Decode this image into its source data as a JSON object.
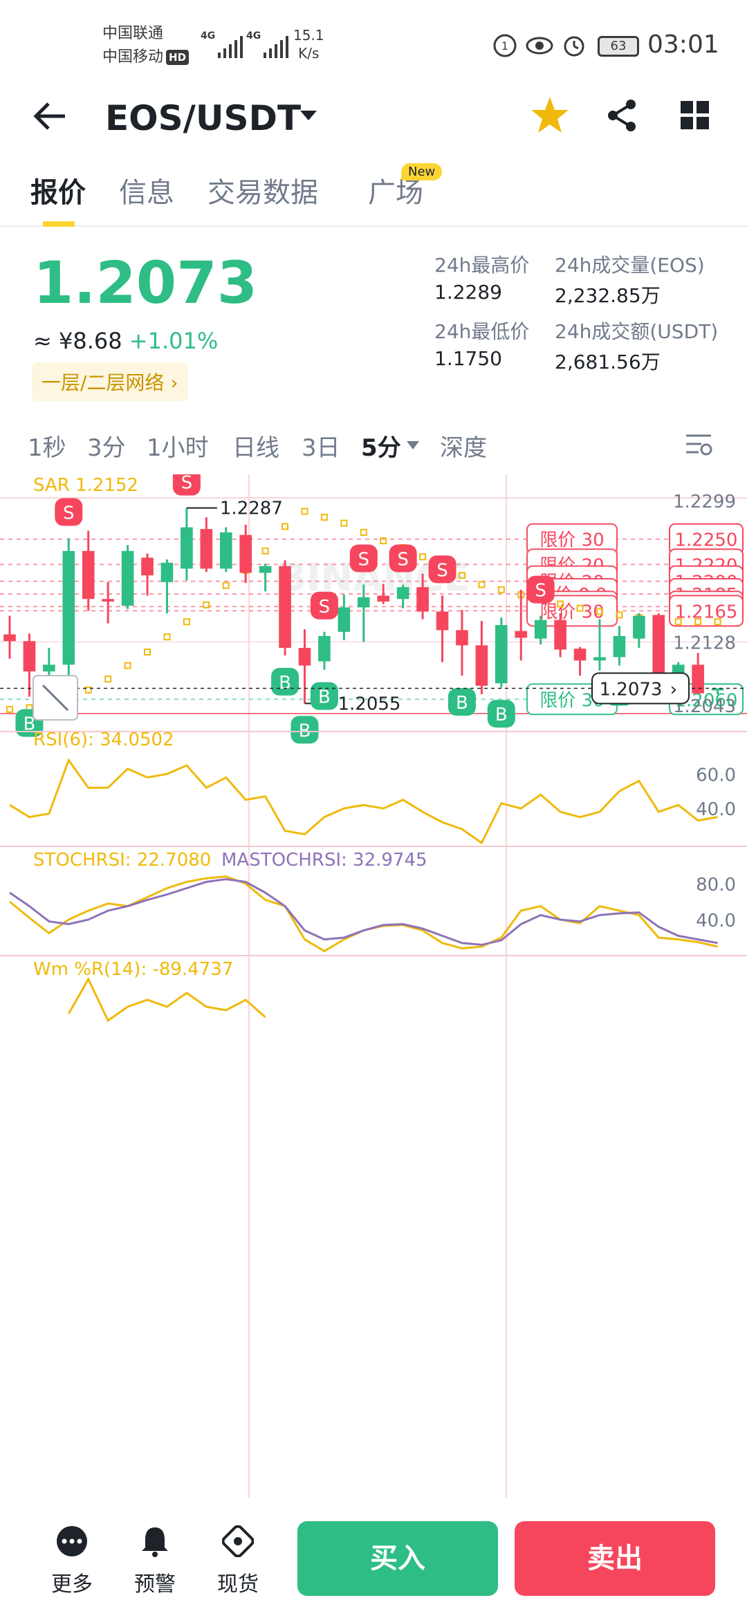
{
  "status_bar": {
    "carrier1": "中国联通",
    "carrier2": "中国移动",
    "hd": "HD",
    "net1": "4G",
    "net2": "4G",
    "speed_value": "15.1",
    "speed_unit": "K/s",
    "battery": "63",
    "time": "03:01"
  },
  "header": {
    "pair": "EOS/USDT",
    "icons": [
      "back-arrow-icon",
      "chevron-down-icon",
      "star-icon",
      "share-icon",
      "grid-icon"
    ],
    "star_color": "#f0b90b"
  },
  "tabs": [
    {
      "label": "报价",
      "active": true
    },
    {
      "label": "信息",
      "active": false
    },
    {
      "label": "交易数据",
      "active": false
    },
    {
      "label": "广场",
      "active": false,
      "badge": "New"
    }
  ],
  "ticker": {
    "price": "1.2073",
    "cny": "≈ ¥8.68",
    "change": "+1.01%",
    "layer_link": "一层/二层网络",
    "high_label": "24h最高价",
    "high": "1.2289",
    "low_label": "24h最低价",
    "low": "1.1750",
    "vol_label": "24h成交量(EOS)",
    "vol": "2,232.85万",
    "amt_label": "24h成交额(USDT)",
    "amt": "2,681.56万"
  },
  "intervals": [
    {
      "label": "1秒"
    },
    {
      "label": "3分"
    },
    {
      "label": "1小时"
    },
    {
      "label": "日线"
    },
    {
      "label": "3日"
    },
    {
      "label": "5分",
      "active": true
    },
    {
      "label": "深度"
    }
  ],
  "colors": {
    "up": "#2ebd85",
    "down": "#f6465d",
    "accent": "#fcd535",
    "sar": "#f0b90b",
    "mastoch": "#8e72b8"
  },
  "chart_data": {
    "type": "candlestick",
    "sar_label": "SAR 1.2152",
    "watermark": "BINANCE",
    "price_axis": [
      "1.2299",
      "1.2250",
      "1.2220",
      "1.2200",
      "1.2185",
      "1.2170",
      "1.2165",
      "1.2128",
      "1.2060",
      "1.2043"
    ],
    "last_price_tag": "1.2073",
    "high_marker": "1.2287",
    "low_marker": "1.2055",
    "order_lines": [
      {
        "label": "限价  30",
        "price": "1.2250",
        "side": "sell"
      },
      {
        "label": "限价  20",
        "price": "1.2220",
        "side": "sell"
      },
      {
        "label": "限价  20",
        "price": "1.2200",
        "side": "sell"
      },
      {
        "label": "限价  9.9",
        "price": "1.2185",
        "side": "sell"
      },
      {
        "label": "限价  30",
        "price": "1.2170",
        "side": "sell"
      },
      {
        "label": "限价  30",
        "price": "1.2165",
        "side": "sell"
      },
      {
        "label": "限价  30",
        "price": "1.2060",
        "side": "buy"
      }
    ],
    "ylim": [
      1.2043,
      1.2299
    ],
    "candles": [
      {
        "o": 1.2137,
        "h": 1.2159,
        "l": 1.2108,
        "c": 1.2129
      },
      {
        "o": 1.2129,
        "h": 1.2138,
        "l": 1.2063,
        "c": 1.2093
      },
      {
        "o": 1.2093,
        "h": 1.2121,
        "l": 1.207,
        "c": 1.2101
      },
      {
        "o": 1.2101,
        "h": 1.2251,
        "l": 1.2082,
        "c": 1.2236
      },
      {
        "o": 1.2236,
        "h": 1.226,
        "l": 1.2165,
        "c": 1.2179
      },
      {
        "o": 1.2179,
        "h": 1.2199,
        "l": 1.215,
        "c": 1.2176
      },
      {
        "o": 1.2171,
        "h": 1.2243,
        "l": 1.2167,
        "c": 1.2236
      },
      {
        "o": 1.2228,
        "h": 1.2233,
        "l": 1.2183,
        "c": 1.2207
      },
      {
        "o": 1.2199,
        "h": 1.2226,
        "l": 1.2162,
        "c": 1.2222
      },
      {
        "o": 1.2215,
        "h": 1.2287,
        "l": 1.2201,
        "c": 1.2264
      },
      {
        "o": 1.2262,
        "h": 1.2276,
        "l": 1.2211,
        "c": 1.2215
      },
      {
        "o": 1.2215,
        "h": 1.2264,
        "l": 1.2211,
        "c": 1.2258
      },
      {
        "o": 1.2255,
        "h": 1.2267,
        "l": 1.2198,
        "c": 1.221
      },
      {
        "o": 1.221,
        "h": 1.2221,
        "l": 1.2188,
        "c": 1.2218
      },
      {
        "o": 1.2218,
        "h": 1.2225,
        "l": 1.2112,
        "c": 1.2121
      },
      {
        "o": 1.2121,
        "h": 1.2143,
        "l": 1.2055,
        "c": 1.21
      },
      {
        "o": 1.2105,
        "h": 1.214,
        "l": 1.2095,
        "c": 1.2135
      },
      {
        "o": 1.214,
        "h": 1.2184,
        "l": 1.213,
        "c": 1.2169
      },
      {
        "o": 1.2169,
        "h": 1.2196,
        "l": 1.2128,
        "c": 1.2181
      },
      {
        "o": 1.2183,
        "h": 1.2197,
        "l": 1.2173,
        "c": 1.2176
      },
      {
        "o": 1.2179,
        "h": 1.2196,
        "l": 1.2168,
        "c": 1.2193
      },
      {
        "o": 1.2193,
        "h": 1.2209,
        "l": 1.2155,
        "c": 1.2164
      },
      {
        "o": 1.2164,
        "h": 1.2183,
        "l": 1.2104,
        "c": 1.2142
      },
      {
        "o": 1.2142,
        "h": 1.2166,
        "l": 1.2088,
        "c": 1.2124
      },
      {
        "o": 1.2124,
        "h": 1.2153,
        "l": 1.2066,
        "c": 1.2076
      },
      {
        "o": 1.2079,
        "h": 1.2157,
        "l": 1.2074,
        "c": 1.2148
      },
      {
        "o": 1.2141,
        "h": 1.219,
        "l": 1.2106,
        "c": 1.2133
      },
      {
        "o": 1.2132,
        "h": 1.2159,
        "l": 1.2125,
        "c": 1.2154
      },
      {
        "o": 1.2154,
        "h": 1.2162,
        "l": 1.211,
        "c": 1.2119
      },
      {
        "o": 1.212,
        "h": 1.2122,
        "l": 1.2088,
        "c": 1.2106
      },
      {
        "o": 1.2106,
        "h": 1.2155,
        "l": 1.2094,
        "c": 1.211
      },
      {
        "o": 1.211,
        "h": 1.2147,
        "l": 1.21,
        "c": 1.2135
      },
      {
        "o": 1.2132,
        "h": 1.2162,
        "l": 1.2121,
        "c": 1.2159
      },
      {
        "o": 1.216,
        "h": 1.2162,
        "l": 1.2081,
        "c": 1.2088
      },
      {
        "o": 1.2088,
        "h": 1.2104,
        "l": 1.2079,
        "c": 1.2101
      },
      {
        "o": 1.2101,
        "h": 1.2115,
        "l": 1.2066,
        "c": 1.2067
      },
      {
        "o": 1.2071,
        "h": 1.2073,
        "l": 1.2066,
        "c": 1.2073
      }
    ],
    "sar": [
      1.2048,
      1.205,
      1.2052,
      1.2059,
      1.2071,
      1.2084,
      1.21,
      1.2116,
      1.2134,
      1.2152,
      1.2172,
      1.2195,
      1.2213,
      1.2236,
      1.2265,
      1.2283,
      1.2276,
      1.2269,
      1.2258,
      1.2248,
      1.224,
      1.2229,
      1.2218,
      1.2207,
      1.2196,
      1.219,
      1.2184,
      1.2178,
      1.2173,
      1.2168,
      1.2164,
      1.216,
      1.2157,
      1.2154,
      1.2152,
      1.2152,
      1.2152
    ],
    "signals": [
      {
        "i": 1,
        "type": "B"
      },
      {
        "i": 3,
        "type": "S"
      },
      {
        "i": 9,
        "type": "S"
      },
      {
        "i": 14,
        "type": "B"
      },
      {
        "i": 15,
        "type": "B"
      },
      {
        "i": 16,
        "type": "S"
      },
      {
        "i": 16,
        "type": "B"
      },
      {
        "i": 18,
        "type": "S"
      },
      {
        "i": 20,
        "type": "S"
      },
      {
        "i": 22,
        "type": "S"
      },
      {
        "i": 23,
        "type": "B"
      },
      {
        "i": 25,
        "type": "B"
      },
      {
        "i": 27,
        "type": "S"
      },
      {
        "i": 31,
        "type": "B"
      }
    ],
    "rsi": {
      "label": "RSI(6): 34.0502",
      "axis": [
        "60.0",
        "40.0"
      ],
      "ylim": [
        18,
        75
      ],
      "values": [
        42,
        35,
        37,
        68,
        52,
        52,
        63,
        58,
        60,
        65,
        52,
        58,
        45,
        47,
        27,
        25,
        35,
        40,
        42,
        40,
        45,
        38,
        32,
        28,
        20,
        43,
        40,
        48,
        38,
        35,
        38,
        50,
        56,
        38,
        42,
        33,
        35
      ]
    },
    "stochrsi": {
      "label": "STOCHRSI: 22.7080",
      "ma_label": "MASTOCHRSI: 32.9745",
      "axis": [
        "80.0",
        "40.0"
      ],
      "ylim": [
        0,
        100
      ],
      "values": [
        60,
        42,
        25,
        40,
        50,
        58,
        55,
        65,
        75,
        82,
        86,
        88,
        80,
        62,
        55,
        18,
        5,
        18,
        28,
        33,
        34,
        28,
        14,
        8,
        10,
        20,
        50,
        55,
        40,
        36,
        55,
        50,
        45,
        20,
        18,
        15,
        10
      ],
      "ma_values": [
        70,
        55,
        38,
        35,
        40,
        50,
        55,
        62,
        68,
        75,
        82,
        85,
        82,
        70,
        55,
        28,
        18,
        20,
        28,
        34,
        35,
        30,
        22,
        14,
        12,
        17,
        35,
        45,
        40,
        38,
        45,
        47,
        48,
        32,
        22,
        18,
        14
      ]
    },
    "wmr": {
      "label": "Wm %R(14): -89.4737"
    }
  },
  "bottom_bar": {
    "more": "更多",
    "alert": "预警",
    "spot": "现货",
    "buy": "买入",
    "sell": "卖出"
  }
}
